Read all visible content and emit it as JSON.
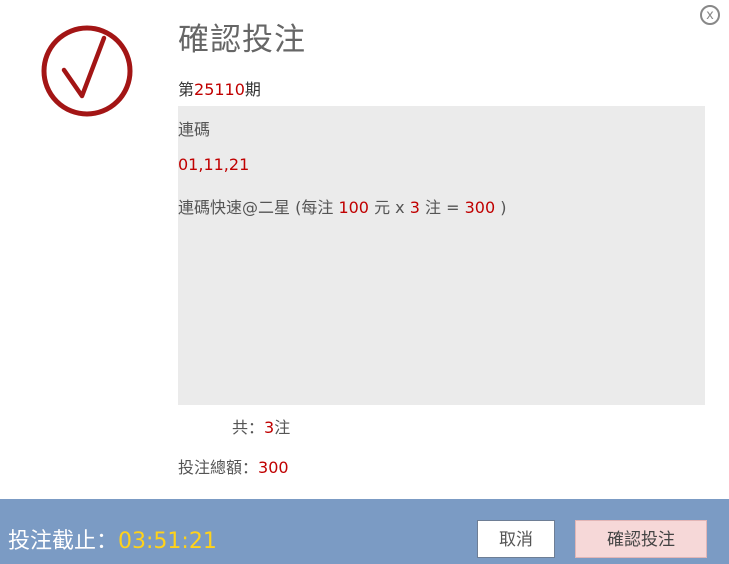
{
  "dialog": {
    "close_label": "x",
    "title": "確認投注",
    "period": {
      "prefix": "第",
      "number": "25110",
      "suffix": "期"
    },
    "details": {
      "line1": "連碼",
      "numbers": "01,11,21",
      "bet": {
        "name": "連碼快速@二星",
        "open": " (每注 ",
        "unit_amount": "100",
        "mid1": " 元 x ",
        "count": "3",
        "mid2": " 注 = ",
        "subtotal": "300",
        "close": " )"
      }
    },
    "summary": {
      "count_label": "共：",
      "count_value": "3",
      "count_unit": "注",
      "total_label": "投注總額：",
      "total_value": "300"
    },
    "footer": {
      "deadline_label": "投注截止：",
      "deadline_time": "03:51:21",
      "cancel_label": "取消",
      "confirm_label": "確認投注"
    },
    "colors": {
      "accent_red": "#c00000",
      "footer_bg": "#7b9bc4",
      "deadline_time": "#ffd21a",
      "confirm_bg": "#f6d8d8"
    }
  }
}
